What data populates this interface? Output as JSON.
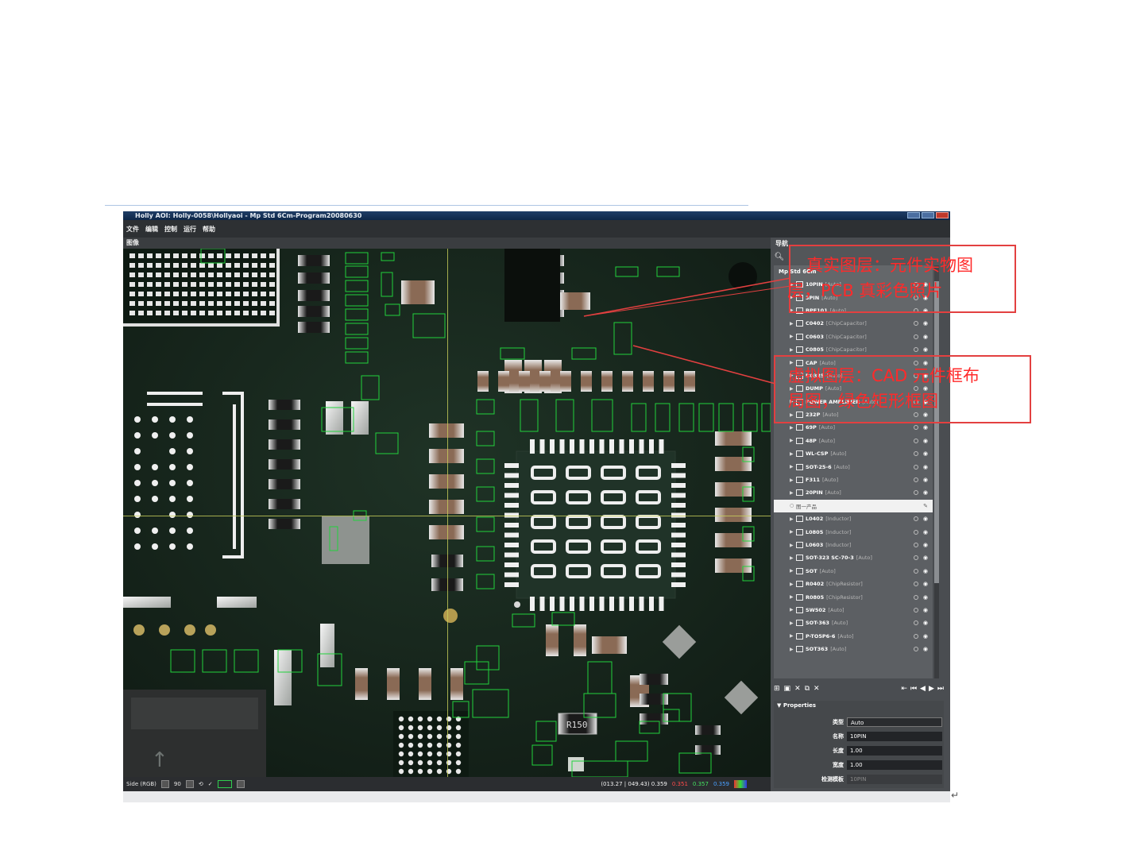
{
  "window": {
    "title": "Holly AOI: Holly-0058\\Hollyaoi - Mp Std 6Cm-Program20080630"
  },
  "menubar": [
    "文件",
    "编辑",
    "控制",
    "运行",
    "帮助"
  ],
  "canvas_toolbar_label": "图像",
  "status": {
    "mode": "Side (RGB)",
    "zoom": "90",
    "coords": "(013.27 | 049.43) 0.359",
    "r": "0.351",
    "g": "0.357",
    "b": "0.359"
  },
  "panel": {
    "title": "导航",
    "root": "Mp Std 6Cm",
    "items": [
      {
        "name": "10PIN",
        "type": "Auto"
      },
      {
        "name": "3PIN",
        "type": "Auto"
      },
      {
        "name": "BPF101",
        "type": "Auto"
      },
      {
        "name": "C0402",
        "type": "ChipCapacitor"
      },
      {
        "name": "C0603",
        "type": "ChipCapacitor"
      },
      {
        "name": "C0805",
        "type": "ChipCapacitor"
      },
      {
        "name": "CAP",
        "type": "Auto"
      },
      {
        "name": "D0325",
        "type": "Auto"
      },
      {
        "name": "DUMP",
        "type": "Auto"
      },
      {
        "name": "POWER AMPLIFIER",
        "type": "Auto"
      },
      {
        "name": "232P",
        "type": "Auto"
      },
      {
        "name": "69P",
        "type": "Auto"
      },
      {
        "name": "48P",
        "type": "Auto"
      },
      {
        "name": "WL-CSP",
        "type": "Auto"
      },
      {
        "name": "SOT-25-6",
        "type": "Auto"
      },
      {
        "name": "F311",
        "type": "Auto"
      },
      {
        "name": "20PIN",
        "type": "Auto"
      },
      {
        "name": "图一产品",
        "type": "",
        "selected": true
      },
      {
        "name": "L0402",
        "type": "Inductor"
      },
      {
        "name": "L0805",
        "type": "Inductor"
      },
      {
        "name": "L0603",
        "type": "Inductor"
      },
      {
        "name": "SOT-323 SC-70-3",
        "type": "Auto"
      },
      {
        "name": "SOT",
        "type": "Auto"
      },
      {
        "name": "R0402",
        "type": "ChipResistor"
      },
      {
        "name": "R0805",
        "type": "ChipResistor"
      },
      {
        "name": "SW502",
        "type": "Auto"
      },
      {
        "name": "SOT-363",
        "type": "Auto"
      },
      {
        "name": "P-TO5P6-6",
        "type": "Auto"
      },
      {
        "name": "SOT363",
        "type": "Auto"
      }
    ],
    "properties_title": "Properties",
    "properties": [
      {
        "label": "类型",
        "value": "Auto"
      },
      {
        "label": "名称",
        "value": "10PIN"
      },
      {
        "label": "长度",
        "value": "1.00"
      },
      {
        "label": "宽度",
        "value": "1.00"
      },
      {
        "label": "检测模板",
        "value": "10PIN"
      }
    ]
  },
  "annotations": {
    "a1_line1": "真实图层：元件实物图",
    "a1_line2": "层，PCB 真彩色照片",
    "a2_line1": "虚拟图层：CAD 元件框布",
    "a2_line2": "局图，绿色矩形框图"
  },
  "colors": {
    "pcb": "#17261d",
    "component_box": "#22d23c",
    "annotation": "#e34040",
    "titlebar": "#1f3d66"
  }
}
